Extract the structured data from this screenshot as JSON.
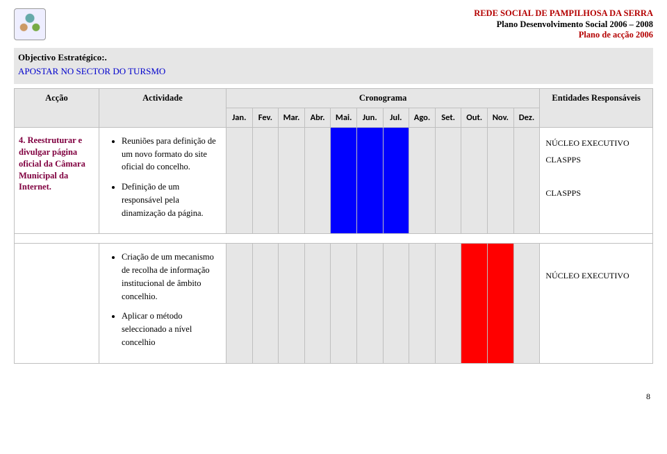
{
  "header": {
    "line1": "REDE SOCIAL DE PAMPILHOSA DA SERRA",
    "line2": "Plano Desenvolvimento Social 2006 – 2008",
    "line3": "Plano de acção 2006"
  },
  "objective": {
    "label": "Objectivo Estratégico:.",
    "text": "APOSTAR NO SECTOR DO TURSMO"
  },
  "table": {
    "headers": {
      "accao": "Acção",
      "actividade": "Actividade",
      "cronograma": "Cronograma",
      "entidades": "Entidades Responsáveis"
    },
    "months": [
      "Jan.",
      "Fev.",
      "Mar.",
      "Abr.",
      "Mai.",
      "Jun.",
      "Jul.",
      "Ago.",
      "Set.",
      "Out.",
      "Nov.",
      "Dez."
    ],
    "rows": [
      {
        "accao": "4. Reestruturar e divulgar página oficial da Câmara Municipal da Internet.",
        "activities": [
          "Reuniões para definição de um novo formato do site oficial do concelho.",
          "Definição de um responsável pela dinamização da página."
        ],
        "entidades": [
          "NÚCLEO EXECUTIVO",
          "CLASPPS",
          "",
          "CLASPPS"
        ],
        "fills": [
          "band",
          "band",
          "band",
          "band",
          "blue",
          "blue",
          "blue",
          "band",
          "band",
          "band",
          "band",
          "band"
        ]
      },
      {
        "accao": "",
        "activities": [
          "Criação de um mecanismo de recolha de informação institucional de âmbito concelhio.",
          "Aplicar o método seleccionado a nível concelhio"
        ],
        "entidades": [
          "",
          "NÚCLEO EXECUTIVO"
        ],
        "fills": [
          "band",
          "band",
          "band",
          "band",
          "band",
          "band",
          "band",
          "band",
          "band",
          "red",
          "red",
          "band"
        ]
      }
    ]
  },
  "pageNumber": "8"
}
